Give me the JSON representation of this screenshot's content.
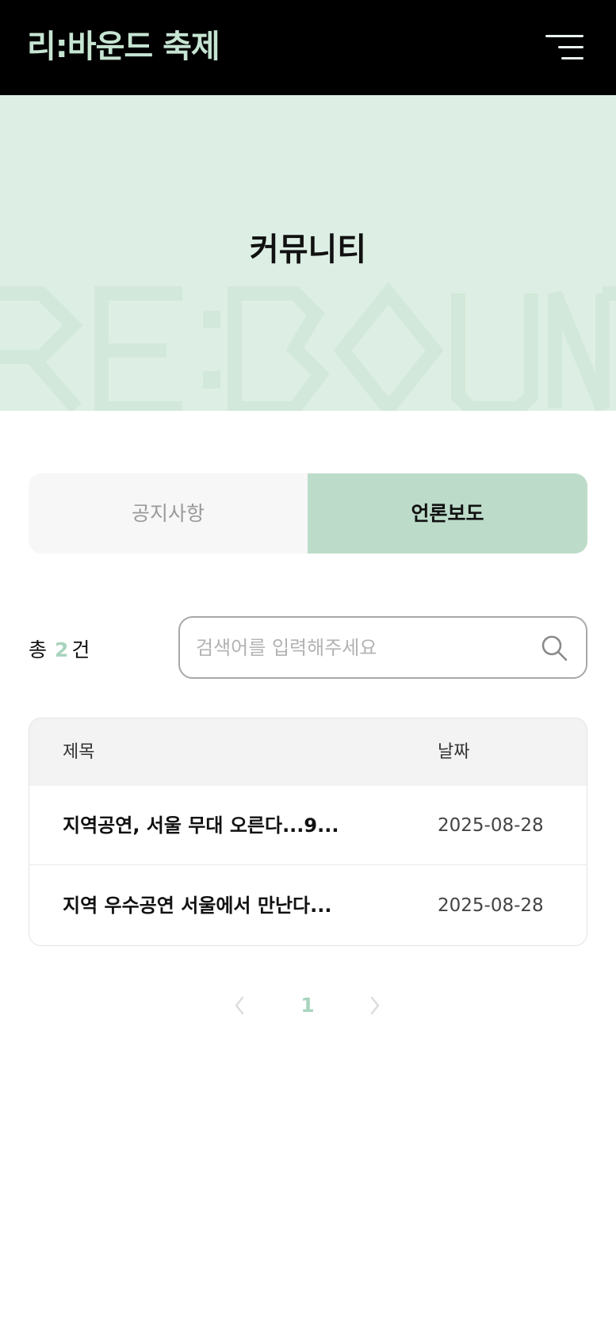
{
  "header": {
    "logo": "리:바운드 축제",
    "menu_icon": "hamburger-menu-icon"
  },
  "hero": {
    "title": "커뮤니티",
    "watermark": "RE:BOUND",
    "background": "#ddefe4"
  },
  "tabs": [
    {
      "label": "공지사항",
      "active": false
    },
    {
      "label": "언론보도",
      "active": true
    }
  ],
  "summary": {
    "prefix": "총",
    "count": "2",
    "suffix": "건"
  },
  "search": {
    "placeholder": "검색어를 입력해주세요",
    "value": "",
    "icon": "search-icon"
  },
  "table": {
    "columns": [
      "제목",
      "날짜"
    ],
    "rows": [
      {
        "title": "지역공연, 서울 무대 오른다...9...",
        "date": "2025-08-28"
      },
      {
        "title": "지역 우수공연 서울에서 만난다...",
        "date": "2025-08-28"
      }
    ]
  },
  "pagination": {
    "current": "1",
    "prev_icon": "chevron-left-icon",
    "next_icon": "chevron-right-icon"
  },
  "colors": {
    "accent": "#bcdcc9",
    "accent_text": "#a8d4bd",
    "header_bg": "#000000",
    "logo": "#c6e4d2"
  }
}
